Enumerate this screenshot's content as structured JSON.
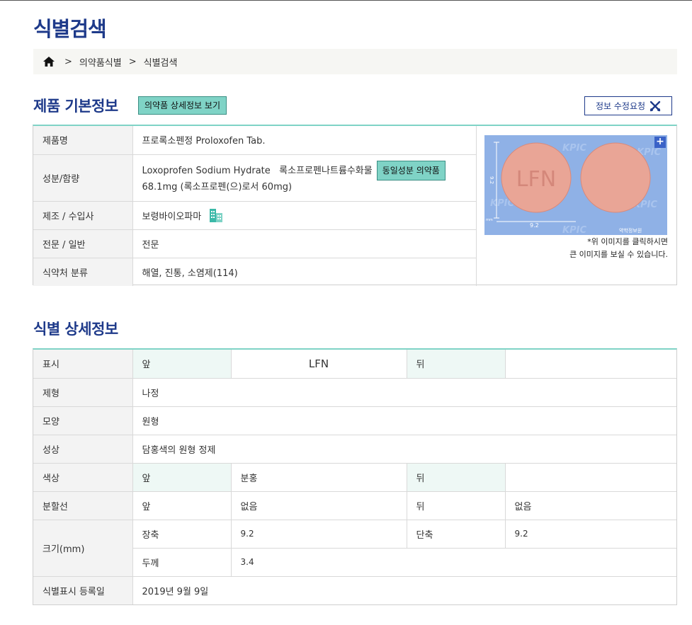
{
  "page": {
    "title": "식별검색"
  },
  "breadcrumb": {
    "items": [
      "의약품식별",
      "식별검색"
    ]
  },
  "basic": {
    "section_title": "제품 기본정보",
    "detail_button": "의약품 상세정보 보기",
    "edit_button": "정보 수정요청",
    "rows": {
      "product_label": "제품명",
      "product_value": "프로록소펜정 Proloxofen Tab.",
      "ingredient_label": "성분/함량",
      "ingredient_line1": "Loxoprofen Sodium Hydrate   록소프로펜나트륨수화물",
      "same_ingredient_button": "동일성분 의약품",
      "ingredient_line2": "68.1mg (록소프로펜(으)로서 60mg)",
      "maker_label": "제조 / 수입사",
      "maker_value": "보령바이오파마",
      "type_label": "전문 / 일반",
      "type_value": "전문",
      "class_label": "식약처 분류",
      "class_value": "해열, 진통, 소염제(114)"
    },
    "image": {
      "imprint": "LFN",
      "caption_line1": "*위 이미지를 클릭하시면",
      "caption_line2": "큰 이미지를 보실 수 있습니다.",
      "watermark": "KPIC",
      "dim_vertical": "9.2",
      "dim_horizontal": "9.2",
      "unit": "mm",
      "logo_text": "약학정보원"
    }
  },
  "detail": {
    "section_title": "식별 상세정보",
    "mark_label": "표시",
    "front": "앞",
    "back": "뒤",
    "mark_front": "LFN",
    "mark_back": "",
    "form_label": "제형",
    "form_value": "나정",
    "shape_label": "모양",
    "shape_value": "원형",
    "appearance_label": "성상",
    "appearance_value": "담홍색의 원형 정제",
    "color_label": "색상",
    "color_front": "분홍",
    "color_back": "",
    "score_label": "분할선",
    "score_front": "없음",
    "score_back": "없음",
    "size_label": "크기(mm)",
    "long_label": "장축",
    "long_value": "9.2",
    "short_label": "단축",
    "short_value": "9.2",
    "thick_label": "두께",
    "thick_value": "3.4",
    "reg_label": "식별표시 등록일",
    "reg_value": "2019년 9월 9일"
  },
  "colors": {
    "accent": "#1e3a8a",
    "teal": "#7fd3c6",
    "pill": "#e9a596"
  }
}
